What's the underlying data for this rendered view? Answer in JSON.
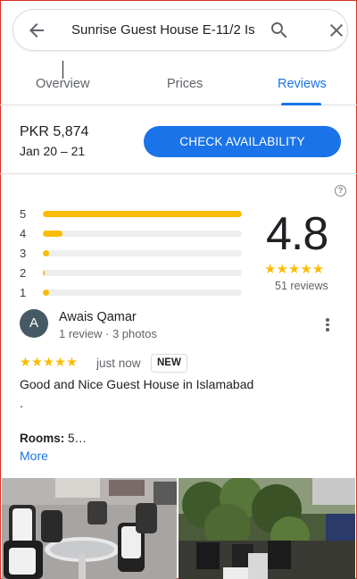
{
  "search": {
    "query": "Sunrise Guest House E-11/2 Is"
  },
  "tabs": [
    {
      "label": "Overview"
    },
    {
      "label": "Prices"
    },
    {
      "label": "Reviews",
      "active": true
    }
  ],
  "pricing": {
    "price": "PKR 5,874",
    "dates": "Jan 20 – 21",
    "button_label": "CHECK AVAILABILITY"
  },
  "summary": {
    "help_glyph": "?",
    "distribution": [
      {
        "stars": "5",
        "fraction": 1.0
      },
      {
        "stars": "4",
        "fraction": 0.1
      },
      {
        "stars": "3",
        "fraction": 0.03
      },
      {
        "stars": "2",
        "fraction": 0.01
      },
      {
        "stars": "1",
        "fraction": 0.03
      }
    ],
    "rating": "4.8",
    "stars_glyphs": "★★★★★",
    "count_label": "51 reviews"
  },
  "review": {
    "avatar_initial": "A",
    "author": "Awais Qamar",
    "meta": "1 review · 3 photos",
    "stars_glyphs": "★★★★★",
    "rating": 5,
    "time": "just now",
    "badge": "NEW",
    "text": "Good and Nice Guest House in Islamabad",
    "text_continuation": ".",
    "rooms_label": "Rooms:",
    "rooms_value": "5…",
    "more_label": "More"
  },
  "colors": {
    "accent": "#1a73e8",
    "star": "#fbbc04",
    "avatar_bg": "#455a64"
  },
  "icons": [
    "arrow-back-icon",
    "search-icon",
    "close-icon",
    "help-icon",
    "more-vert-icon"
  ]
}
